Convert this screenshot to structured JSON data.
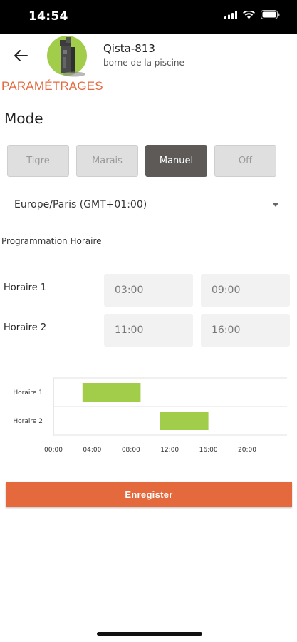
{
  "status_bar": {
    "time": "14:54"
  },
  "device": {
    "name": "Qista-813",
    "subtitle": "borne de la piscine"
  },
  "section_title": "PARAMÉTRAGES",
  "mode": {
    "label": "Mode",
    "options": [
      "Tigre",
      "Marais",
      "Manuel",
      "Off"
    ],
    "selected": "Manuel"
  },
  "timezone": {
    "value": "Europe/Paris (GMT+01:00)"
  },
  "programming": {
    "label": "Programmation Horaire",
    "schedules": [
      {
        "label": "Horaire 1",
        "start": "03:00",
        "end": "09:00"
      },
      {
        "label": "Horaire 2",
        "start": "11:00",
        "end": "16:00"
      }
    ]
  },
  "chart_data": {
    "type": "bar",
    "orientation": "horizontal-range",
    "categories": [
      "Horaire 1",
      "Horaire 2"
    ],
    "ranges": [
      [
        3,
        9
      ],
      [
        11,
        16
      ]
    ],
    "xlim": [
      0,
      24
    ],
    "xticks": [
      "00:00",
      "04:00",
      "08:00",
      "12:00",
      "16:00",
      "20:00"
    ],
    "bar_color": "#a2cd4a",
    "grid": "row separators"
  },
  "save": {
    "label": "Enregister"
  },
  "colors": {
    "accent": "#e4693d",
    "green": "#a2cd4a",
    "selected": "#5e5a58"
  }
}
